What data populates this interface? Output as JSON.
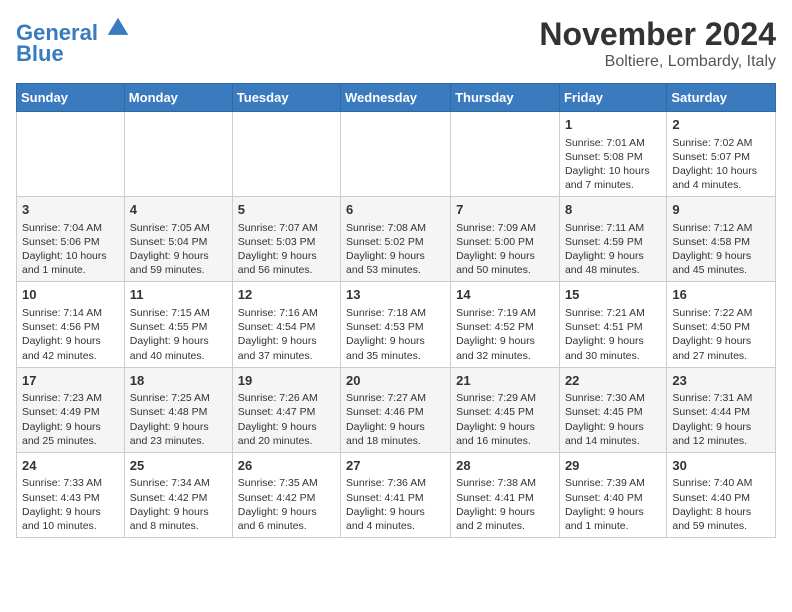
{
  "logo": {
    "line1": "General",
    "line2": "Blue"
  },
  "header": {
    "month": "November 2024",
    "location": "Boltiere, Lombardy, Italy"
  },
  "weekdays": [
    "Sunday",
    "Monday",
    "Tuesday",
    "Wednesday",
    "Thursday",
    "Friday",
    "Saturday"
  ],
  "weeks": [
    [
      {
        "day": "",
        "info": ""
      },
      {
        "day": "",
        "info": ""
      },
      {
        "day": "",
        "info": ""
      },
      {
        "day": "",
        "info": ""
      },
      {
        "day": "",
        "info": ""
      },
      {
        "day": "1",
        "info": "Sunrise: 7:01 AM\nSunset: 5:08 PM\nDaylight: 10 hours and 7 minutes."
      },
      {
        "day": "2",
        "info": "Sunrise: 7:02 AM\nSunset: 5:07 PM\nDaylight: 10 hours and 4 minutes."
      }
    ],
    [
      {
        "day": "3",
        "info": "Sunrise: 7:04 AM\nSunset: 5:06 PM\nDaylight: 10 hours and 1 minute."
      },
      {
        "day": "4",
        "info": "Sunrise: 7:05 AM\nSunset: 5:04 PM\nDaylight: 9 hours and 59 minutes."
      },
      {
        "day": "5",
        "info": "Sunrise: 7:07 AM\nSunset: 5:03 PM\nDaylight: 9 hours and 56 minutes."
      },
      {
        "day": "6",
        "info": "Sunrise: 7:08 AM\nSunset: 5:02 PM\nDaylight: 9 hours and 53 minutes."
      },
      {
        "day": "7",
        "info": "Sunrise: 7:09 AM\nSunset: 5:00 PM\nDaylight: 9 hours and 50 minutes."
      },
      {
        "day": "8",
        "info": "Sunrise: 7:11 AM\nSunset: 4:59 PM\nDaylight: 9 hours and 48 minutes."
      },
      {
        "day": "9",
        "info": "Sunrise: 7:12 AM\nSunset: 4:58 PM\nDaylight: 9 hours and 45 minutes."
      }
    ],
    [
      {
        "day": "10",
        "info": "Sunrise: 7:14 AM\nSunset: 4:56 PM\nDaylight: 9 hours and 42 minutes."
      },
      {
        "day": "11",
        "info": "Sunrise: 7:15 AM\nSunset: 4:55 PM\nDaylight: 9 hours and 40 minutes."
      },
      {
        "day": "12",
        "info": "Sunrise: 7:16 AM\nSunset: 4:54 PM\nDaylight: 9 hours and 37 minutes."
      },
      {
        "day": "13",
        "info": "Sunrise: 7:18 AM\nSunset: 4:53 PM\nDaylight: 9 hours and 35 minutes."
      },
      {
        "day": "14",
        "info": "Sunrise: 7:19 AM\nSunset: 4:52 PM\nDaylight: 9 hours and 32 minutes."
      },
      {
        "day": "15",
        "info": "Sunrise: 7:21 AM\nSunset: 4:51 PM\nDaylight: 9 hours and 30 minutes."
      },
      {
        "day": "16",
        "info": "Sunrise: 7:22 AM\nSunset: 4:50 PM\nDaylight: 9 hours and 27 minutes."
      }
    ],
    [
      {
        "day": "17",
        "info": "Sunrise: 7:23 AM\nSunset: 4:49 PM\nDaylight: 9 hours and 25 minutes."
      },
      {
        "day": "18",
        "info": "Sunrise: 7:25 AM\nSunset: 4:48 PM\nDaylight: 9 hours and 23 minutes."
      },
      {
        "day": "19",
        "info": "Sunrise: 7:26 AM\nSunset: 4:47 PM\nDaylight: 9 hours and 20 minutes."
      },
      {
        "day": "20",
        "info": "Sunrise: 7:27 AM\nSunset: 4:46 PM\nDaylight: 9 hours and 18 minutes."
      },
      {
        "day": "21",
        "info": "Sunrise: 7:29 AM\nSunset: 4:45 PM\nDaylight: 9 hours and 16 minutes."
      },
      {
        "day": "22",
        "info": "Sunrise: 7:30 AM\nSunset: 4:45 PM\nDaylight: 9 hours and 14 minutes."
      },
      {
        "day": "23",
        "info": "Sunrise: 7:31 AM\nSunset: 4:44 PM\nDaylight: 9 hours and 12 minutes."
      }
    ],
    [
      {
        "day": "24",
        "info": "Sunrise: 7:33 AM\nSunset: 4:43 PM\nDaylight: 9 hours and 10 minutes."
      },
      {
        "day": "25",
        "info": "Sunrise: 7:34 AM\nSunset: 4:42 PM\nDaylight: 9 hours and 8 minutes."
      },
      {
        "day": "26",
        "info": "Sunrise: 7:35 AM\nSunset: 4:42 PM\nDaylight: 9 hours and 6 minutes."
      },
      {
        "day": "27",
        "info": "Sunrise: 7:36 AM\nSunset: 4:41 PM\nDaylight: 9 hours and 4 minutes."
      },
      {
        "day": "28",
        "info": "Sunrise: 7:38 AM\nSunset: 4:41 PM\nDaylight: 9 hours and 2 minutes."
      },
      {
        "day": "29",
        "info": "Sunrise: 7:39 AM\nSunset: 4:40 PM\nDaylight: 9 hours and 1 minute."
      },
      {
        "day": "30",
        "info": "Sunrise: 7:40 AM\nSunset: 4:40 PM\nDaylight: 8 hours and 59 minutes."
      }
    ]
  ]
}
